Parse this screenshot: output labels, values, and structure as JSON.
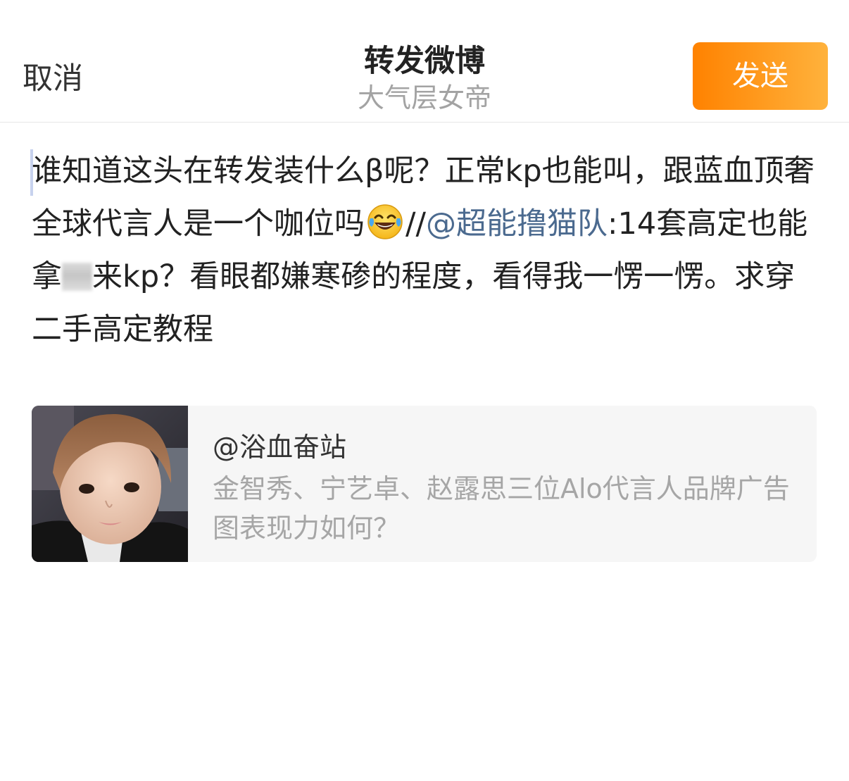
{
  "header": {
    "cancel_label": "取消",
    "title": "转发微博",
    "subtitle": "大气层女帝",
    "send_label": "发送"
  },
  "compose": {
    "text_part1": "谁知道这头在转发装什么β呢？正常kp也能叫，跟蓝血顶奢全球代言人是一个咖位吗",
    "emoji_icon": "laughing-tears-emoji-icon",
    "text_slashes": "//",
    "mention": "@超能撸猫队",
    "text_part2a": ":14套高定也能拿",
    "text_part2b": "来kp？看眼都嫌寒碜的程度，看得我一愣一愣。求穿二手高定教程",
    "mention_color": "#4b6a8f"
  },
  "quoted": {
    "username": "@浴血奋站",
    "content": "金智秀、宁艺卓、赵露思三位Alo代言人品牌广告图表现力如何？"
  },
  "colors": {
    "send_gradient_start": "#ff8200",
    "send_gradient_end": "#ffb23c",
    "subtitle": "#a3a3a3",
    "card_background": "#f6f6f6"
  }
}
